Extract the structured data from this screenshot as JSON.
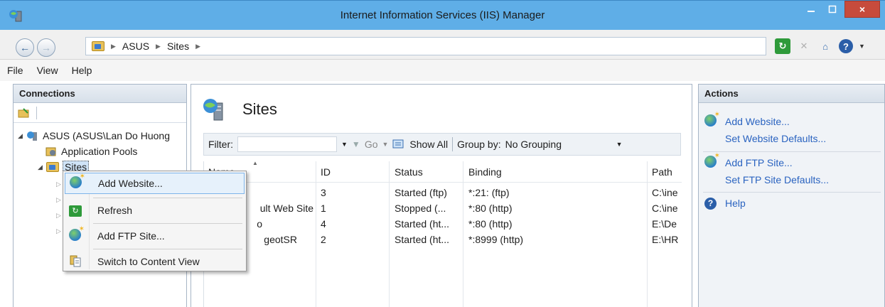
{
  "window": {
    "title": "Internet Information Services (IIS) Manager",
    "minimize_icon": "minimize-icon",
    "maximize_icon": "maximize-icon",
    "close_glyph": "×"
  },
  "address": {
    "crumbs": [
      "ASUS",
      "Sites"
    ]
  },
  "menu": {
    "items": [
      "File",
      "View",
      "Help"
    ]
  },
  "connections": {
    "header": "Connections",
    "tree": {
      "server": "ASUS (ASUS\\Lan Do Huong",
      "app_pools": "Application Pools",
      "sites": "Sites"
    }
  },
  "main": {
    "title": "Sites",
    "filter_label": "Filter:",
    "go_label": "Go",
    "show_all_label": "Show All",
    "group_by_label": "Group by:",
    "group_by_value": "No Grouping",
    "columns": [
      "Name",
      "ID",
      "Status",
      "Binding",
      "Path"
    ],
    "rows": [
      {
        "name": "",
        "id": "3",
        "status": "Started (ftp)",
        "binding": "*:21: (ftp)",
        "path": "C:\\ine"
      },
      {
        "name": "ult Web Site",
        "id": "1",
        "status": "Stopped (...",
        "binding": "*:80 (http)",
        "path": "C:\\ine"
      },
      {
        "name": "o",
        "id": "4",
        "status": "Started (ht...",
        "binding": "*:80 (http)",
        "path": "E:\\De"
      },
      {
        "name": "geotSR",
        "id": "2",
        "status": "Started (ht...",
        "binding": "*:8999 (http)",
        "path": "E:\\HR"
      }
    ]
  },
  "actions": {
    "header": "Actions",
    "add_website": "Add Website...",
    "set_website_defaults": "Set Website Defaults...",
    "add_ftp": "Add FTP Site...",
    "set_ftp_defaults": "Set FTP Site Defaults...",
    "help": "Help"
  },
  "context_menu": {
    "items": [
      "Add Website...",
      "Refresh",
      "Add FTP Site...",
      "Switch to Content View"
    ],
    "highlighted": "Add Website..."
  },
  "colors": {
    "titlebar": "#5faee7",
    "close_button": "#c74b3c",
    "link": "#2a63c0"
  }
}
